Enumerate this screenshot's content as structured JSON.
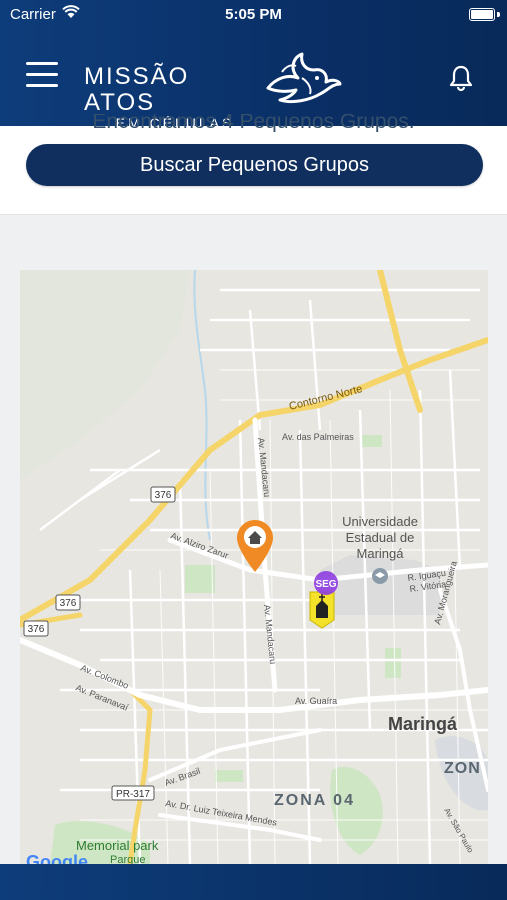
{
  "status_bar": {
    "carrier": "Carrier",
    "time": "5:05 PM"
  },
  "header": {
    "logo_main": "MISSÃO ATOS",
    "logo_sub": "EM CÉLULAS"
  },
  "card": {
    "subtitle": "Encontramos 4 Pequenos Grupos.",
    "search_button": "Buscar Pequenos Grupos"
  },
  "map": {
    "labels": {
      "contorno_norte": "Contorno Norte",
      "av_palmeiras": "Av. das Palmeiras",
      "av_mandacaru_top": "Av. Mandacaru",
      "av_mandacaru_bottom": "Av. Mandacaru",
      "av_alziro_zarur": "Av. Alziro Zarur",
      "road_376_a": "376",
      "road_376_b": "376",
      "road_376_c": "376",
      "university_1": "Universidade",
      "university_2": "Estadual de",
      "university_3": "Maringá",
      "r_iguacu": "R. Iguaçu",
      "r_vitoria": "R. Vitória",
      "av_morangueira": "Av. Morangueira",
      "av_colombo": "Av. Colombo",
      "av_paranavai": "Av. Paranavaí",
      "av_guaira": "Av. Guaíra",
      "maringa": "Maringá",
      "zona_right": "ZON",
      "av_brasil": "Av. Brasil",
      "pr317": "PR-317",
      "av_luiz": "Av. Dr. Luiz Teixeira Mendes",
      "zona_04": "ZONA 04",
      "av_sao_paulo": "Av. São Paulo",
      "memorial_park": "Memorial park",
      "parque": "Parque",
      "google": "Google"
    },
    "church_marker_day": "SEG"
  },
  "colors": {
    "header": "#0a2f66",
    "button": "#102f5e",
    "marker_home": "#f08a24",
    "marker_church": "#f3e229",
    "road_major": "#f5d56a"
  }
}
